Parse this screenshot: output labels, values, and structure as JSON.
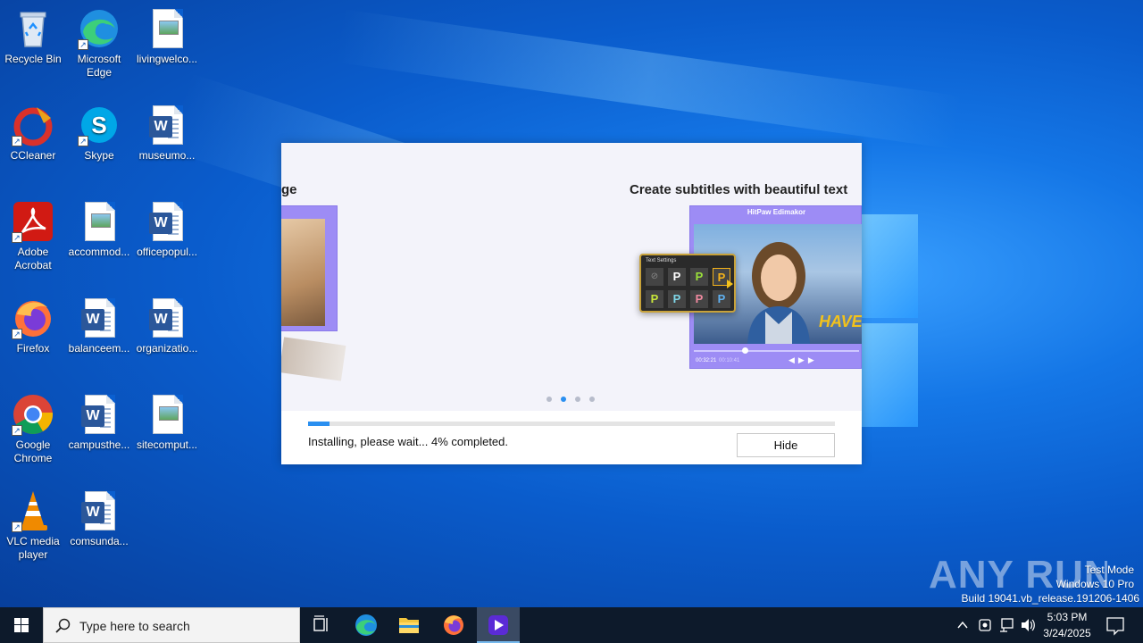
{
  "desktop_icons": [
    {
      "label": "Recycle Bin",
      "type": "recycle"
    },
    {
      "label": "Microsoft Edge",
      "type": "edge"
    },
    {
      "label": "livingwelco...",
      "type": "image"
    },
    {
      "label": "CCleaner",
      "type": "ccleaner"
    },
    {
      "label": "Skype",
      "type": "skype"
    },
    {
      "label": "museumo...",
      "type": "word"
    },
    {
      "label": "Adobe Acrobat",
      "type": "acrobat"
    },
    {
      "label": "accommod...",
      "type": "image"
    },
    {
      "label": "officepopul...",
      "type": "word"
    },
    {
      "label": "Firefox",
      "type": "firefox"
    },
    {
      "label": "balanceem...",
      "type": "word"
    },
    {
      "label": "organizatio...",
      "type": "word"
    },
    {
      "label": "Google Chrome",
      "type": "chrome"
    },
    {
      "label": "campusthe...",
      "type": "word"
    },
    {
      "label": "sitecomput...",
      "type": "image"
    },
    {
      "label": "VLC media player",
      "type": "vlc"
    },
    {
      "label": "comsunda...",
      "type": "word"
    }
  ],
  "installer": {
    "slide_left_title": "ge",
    "slide_right_title": "Create subtitles with beautiful text",
    "card_header": "HitPaw Edimakor",
    "popup_title": "Text Settings",
    "popup_letter": "P",
    "overlay_word": "HAVE",
    "timecode_left": "00:32:21",
    "timecode_right": "00:10:41",
    "progress_fraction": 0.04,
    "status_text": "Installing, please wait... 4% completed.",
    "hide_label": "Hide",
    "active_dot": 1,
    "dot_count": 4
  },
  "watermark": {
    "logo_text": "ANY RUN",
    "line1": "Test Mode",
    "line2": "Windows 10 Pro",
    "line3": "Build 19041.vb_release.191206-1406"
  },
  "taskbar": {
    "search_placeholder": "Type here to search",
    "clock_time": "5:03 PM",
    "clock_date": "3/24/2025"
  },
  "colors": {
    "accent": "#2a8ff0",
    "card_purple": "#9d8cf5",
    "taskbar": "#0d1a2b"
  }
}
